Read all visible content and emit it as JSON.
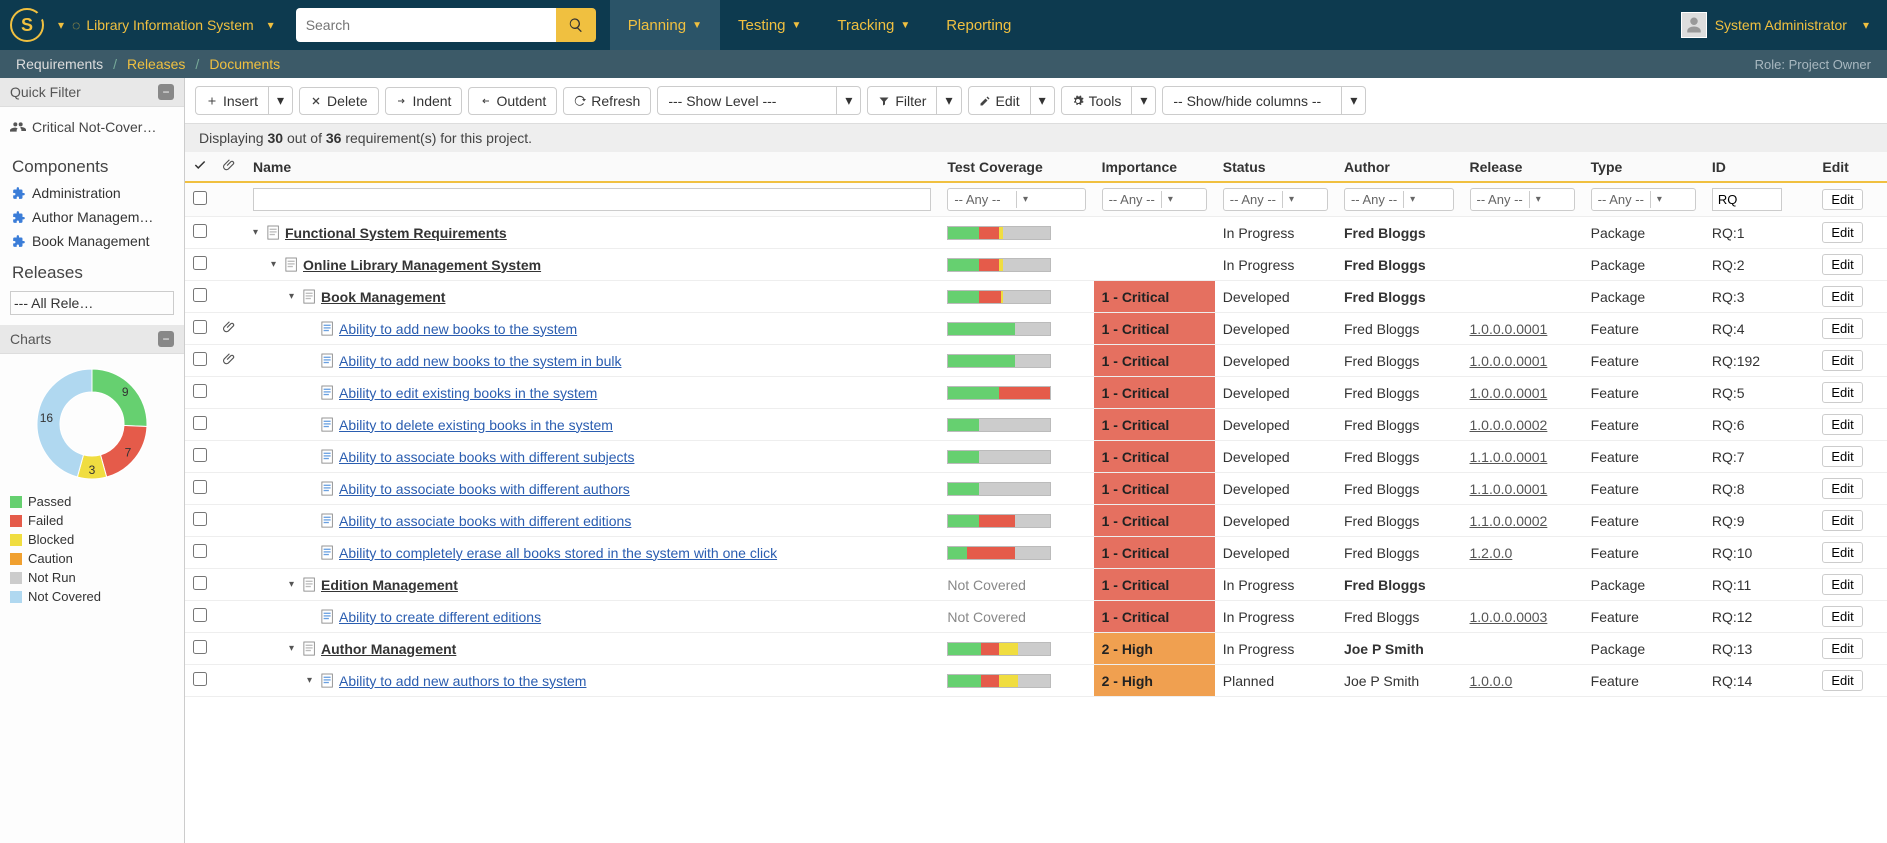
{
  "header": {
    "workspace": "Library Information System",
    "search_placeholder": "Search",
    "nav": [
      {
        "label": "Planning",
        "active": true,
        "caret": true
      },
      {
        "label": "Testing",
        "active": false,
        "caret": true
      },
      {
        "label": "Tracking",
        "active": false,
        "caret": true
      },
      {
        "label": "Reporting",
        "active": false,
        "caret": false
      }
    ],
    "user": "System Administrator"
  },
  "subnav": {
    "items": [
      "Requirements",
      "Releases",
      "Documents"
    ],
    "current_index": 0,
    "role_label": "Role:",
    "role_value": "Project Owner"
  },
  "sidebar": {
    "quick_filter_title": "Quick Filter",
    "quick_filter_item": "Critical Not-Cover…",
    "components_title": "Components",
    "components": [
      "Administration",
      "Author Managem…",
      "Book Management"
    ],
    "releases_title": "Releases",
    "releases_select": "--- All Rele…",
    "charts_title": "Charts"
  },
  "chart_data": {
    "type": "pie",
    "title": "",
    "series": [
      {
        "name": "Passed",
        "value": 9,
        "color": "#66d070"
      },
      {
        "name": "Failed",
        "value": 7,
        "color": "#e55b4a"
      },
      {
        "name": "Blocked",
        "value": 3,
        "color": "#f0dd40"
      },
      {
        "name": "Caution",
        "value": 0,
        "color": "#f0a030"
      },
      {
        "name": "Not Run",
        "value": 0,
        "color": "#cccccc"
      },
      {
        "name": "Not Covered",
        "value": 16,
        "color": "#b0d8f0"
      }
    ],
    "visible_labels": [
      3,
      7,
      9,
      16
    ]
  },
  "toolbar": {
    "insert": "Insert",
    "delete": "Delete",
    "indent": "Indent",
    "outdent": "Outdent",
    "refresh": "Refresh",
    "show_level": "--- Show Level ---",
    "filter": "Filter",
    "edit": "Edit",
    "tools": "Tools",
    "columns": "-- Show/hide columns --"
  },
  "info_bar": {
    "prefix": "Displaying ",
    "count": "30",
    "mid": " out of ",
    "total": "36",
    "suffix": " requirement(s) for this project."
  },
  "columns": {
    "name": "Name",
    "coverage": "Test Coverage",
    "importance": "Importance",
    "status": "Status",
    "author": "Author",
    "release": "Release",
    "type": "Type",
    "id": "ID",
    "edit": "Edit"
  },
  "filters": {
    "any": "-- Any --",
    "id_prefix": "RQ",
    "edit": "Edit"
  },
  "rows": [
    {
      "indent": 0,
      "expander": true,
      "icon": "package",
      "name": "Functional System Requirements",
      "bold": true,
      "attach": false,
      "coverage": [
        30,
        20,
        4,
        46
      ],
      "importance": "",
      "status": "In Progress",
      "author": "Fred Bloggs",
      "author_bold": true,
      "release": "",
      "type": "Package",
      "id": "RQ:1"
    },
    {
      "indent": 1,
      "expander": true,
      "icon": "package",
      "name": "Online Library Management System",
      "bold": true,
      "attach": false,
      "coverage": [
        30,
        20,
        4,
        46
      ],
      "importance": "",
      "status": "In Progress",
      "author": "Fred Bloggs",
      "author_bold": true,
      "release": "",
      "type": "Package",
      "id": "RQ:2"
    },
    {
      "indent": 2,
      "expander": true,
      "icon": "package",
      "name": "Book Management",
      "bold": true,
      "attach": false,
      "coverage": [
        30,
        22,
        2,
        46
      ],
      "importance": "1 - Critical",
      "status": "Developed",
      "author": "Fred Bloggs",
      "author_bold": true,
      "release": "",
      "type": "Package",
      "id": "RQ:3"
    },
    {
      "indent": 3,
      "expander": false,
      "icon": "feature",
      "name": "Ability to add new books to the system",
      "bold": false,
      "attach": true,
      "coverage": [
        65,
        0,
        0,
        35
      ],
      "importance": "1 - Critical",
      "status": "Developed",
      "author": "Fred Bloggs",
      "author_bold": false,
      "release": "1.0.0.0.0001",
      "type": "Feature",
      "id": "RQ:4"
    },
    {
      "indent": 3,
      "expander": false,
      "icon": "feature",
      "name": "Ability to add new books to the system in bulk",
      "bold": false,
      "attach": true,
      "coverage": [
        65,
        0,
        0,
        35
      ],
      "importance": "1 - Critical",
      "status": "Developed",
      "author": "Fred Bloggs",
      "author_bold": false,
      "release": "1.0.0.0.0001",
      "type": "Feature",
      "id": "RQ:192"
    },
    {
      "indent": 3,
      "expander": false,
      "icon": "feature",
      "name": "Ability to edit existing books in the system",
      "bold": false,
      "attach": false,
      "coverage": [
        50,
        50,
        0,
        0
      ],
      "importance": "1 - Critical",
      "status": "Developed",
      "author": "Fred Bloggs",
      "author_bold": false,
      "release": "1.0.0.0.0001",
      "type": "Feature",
      "id": "RQ:5"
    },
    {
      "indent": 3,
      "expander": false,
      "icon": "feature",
      "name": "Ability to delete existing books in the system",
      "bold": false,
      "attach": false,
      "coverage": [
        30,
        0,
        0,
        70
      ],
      "importance": "1 - Critical",
      "status": "Developed",
      "author": "Fred Bloggs",
      "author_bold": false,
      "release": "1.0.0.0.0002",
      "type": "Feature",
      "id": "RQ:6"
    },
    {
      "indent": 3,
      "expander": false,
      "icon": "feature",
      "name": "Ability to associate books with different subjects",
      "bold": false,
      "attach": false,
      "coverage": [
        30,
        0,
        0,
        70
      ],
      "importance": "1 - Critical",
      "status": "Developed",
      "author": "Fred Bloggs",
      "author_bold": false,
      "release": "1.1.0.0.0001",
      "type": "Feature",
      "id": "RQ:7"
    },
    {
      "indent": 3,
      "expander": false,
      "icon": "feature",
      "name": "Ability to associate books with different authors",
      "bold": false,
      "attach": false,
      "coverage": [
        30,
        0,
        0,
        70
      ],
      "importance": "1 - Critical",
      "status": "Developed",
      "author": "Fred Bloggs",
      "author_bold": false,
      "release": "1.1.0.0.0001",
      "type": "Feature",
      "id": "RQ:8"
    },
    {
      "indent": 3,
      "expander": false,
      "icon": "feature",
      "name": "Ability to associate books with different editions",
      "bold": false,
      "attach": false,
      "coverage": [
        30,
        35,
        0,
        35
      ],
      "importance": "1 - Critical",
      "status": "Developed",
      "author": "Fred Bloggs",
      "author_bold": false,
      "release": "1.1.0.0.0002",
      "type": "Feature",
      "id": "RQ:9"
    },
    {
      "indent": 3,
      "expander": false,
      "icon": "feature",
      "name": "Ability to completely erase all books stored in the system with one click",
      "bold": false,
      "attach": false,
      "coverage": [
        18,
        47,
        0,
        35
      ],
      "importance": "1 - Critical",
      "status": "Developed",
      "author": "Fred Bloggs",
      "author_bold": false,
      "release": "1.2.0.0",
      "type": "Feature",
      "id": "RQ:10"
    },
    {
      "indent": 2,
      "expander": true,
      "icon": "package",
      "name": "Edition Management",
      "bold": true,
      "attach": false,
      "coverage": null,
      "coverage_text": "Not Covered",
      "importance": "1 - Critical",
      "status": "In Progress",
      "author": "Fred Bloggs",
      "author_bold": true,
      "release": "",
      "type": "Package",
      "id": "RQ:11"
    },
    {
      "indent": 3,
      "expander": false,
      "icon": "feature",
      "name": "Ability to create different editions",
      "bold": false,
      "attach": false,
      "coverage": null,
      "coverage_text": "Not Covered",
      "importance": "1 - Critical",
      "status": "In Progress",
      "author": "Fred Bloggs",
      "author_bold": false,
      "release": "1.0.0.0.0003",
      "type": "Feature",
      "id": "RQ:12"
    },
    {
      "indent": 2,
      "expander": true,
      "icon": "package",
      "name": "Author Management",
      "bold": true,
      "attach": false,
      "coverage": [
        32,
        18,
        18,
        32
      ],
      "importance": "2 - High",
      "status": "In Progress",
      "author": "Joe P Smith",
      "author_bold": true,
      "release": "",
      "type": "Package",
      "id": "RQ:13"
    },
    {
      "indent": 3,
      "expander": true,
      "icon": "feature",
      "name": "Ability to add new authors to the system",
      "bold": false,
      "attach": false,
      "coverage": [
        32,
        18,
        18,
        32
      ],
      "importance": "2 - High",
      "status": "Planned",
      "author": "Joe P Smith",
      "author_bold": false,
      "release": "1.0.0.0",
      "type": "Feature",
      "id": "RQ:14"
    }
  ],
  "edit_label": "Edit",
  "legend": [
    {
      "label": "Passed",
      "color": "#66d070"
    },
    {
      "label": "Failed",
      "color": "#e55b4a"
    },
    {
      "label": "Blocked",
      "color": "#f0dd40"
    },
    {
      "label": "Caution",
      "color": "#f0a030"
    },
    {
      "label": "Not Run",
      "color": "#cccccc"
    },
    {
      "label": "Not Covered",
      "color": "#b0d8f0"
    }
  ]
}
